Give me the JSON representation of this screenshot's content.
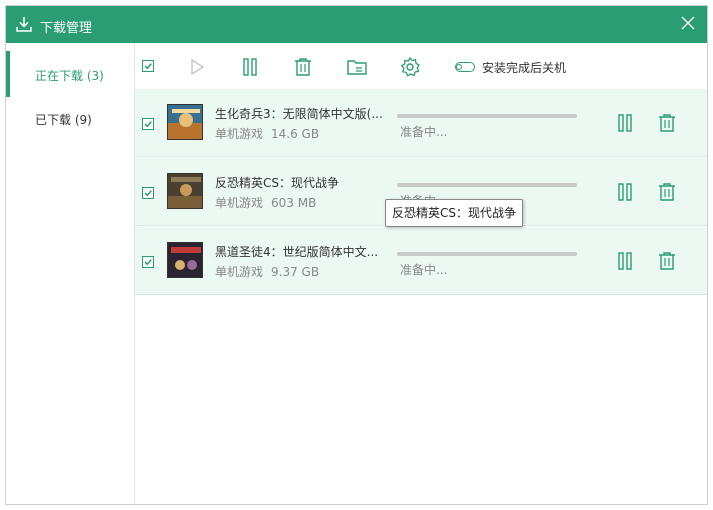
{
  "window": {
    "title": "下载管理",
    "accent_color": "#2a9d72",
    "icons": {
      "title": "download-icon",
      "close": "close-icon"
    }
  },
  "sidebar": {
    "items": [
      {
        "label": "正在下载 (3)",
        "active": true
      },
      {
        "label": "已下载 (9)",
        "active": false
      }
    ]
  },
  "toolbar": {
    "select_all_checked": true,
    "buttons": [
      "checkbox-select-all",
      "play-icon",
      "pause-icon",
      "trash-icon",
      "folder-icon",
      "gear-icon"
    ],
    "shutdown_toggle_label": "安装完成后关机",
    "shutdown_toggle_on": false
  },
  "downloads": [
    {
      "name": "生化奇兵3：无限简体中文版(...",
      "category": "单机游戏",
      "size": "14.6 GB",
      "status": "准备中...",
      "progress": 0,
      "checked": true
    },
    {
      "name": "反恐精英CS：现代战争",
      "category": "单机游戏",
      "size": "603 MB",
      "status": "准备中...",
      "progress": 0,
      "checked": true
    },
    {
      "name": "黑道圣徒4：世纪版简体中文...",
      "category": "单机游戏",
      "size": "9.37 GB",
      "status": "准备中...",
      "progress": 0,
      "checked": true
    }
  ],
  "tooltip": {
    "text": "反恐精英CS：现代战争"
  }
}
